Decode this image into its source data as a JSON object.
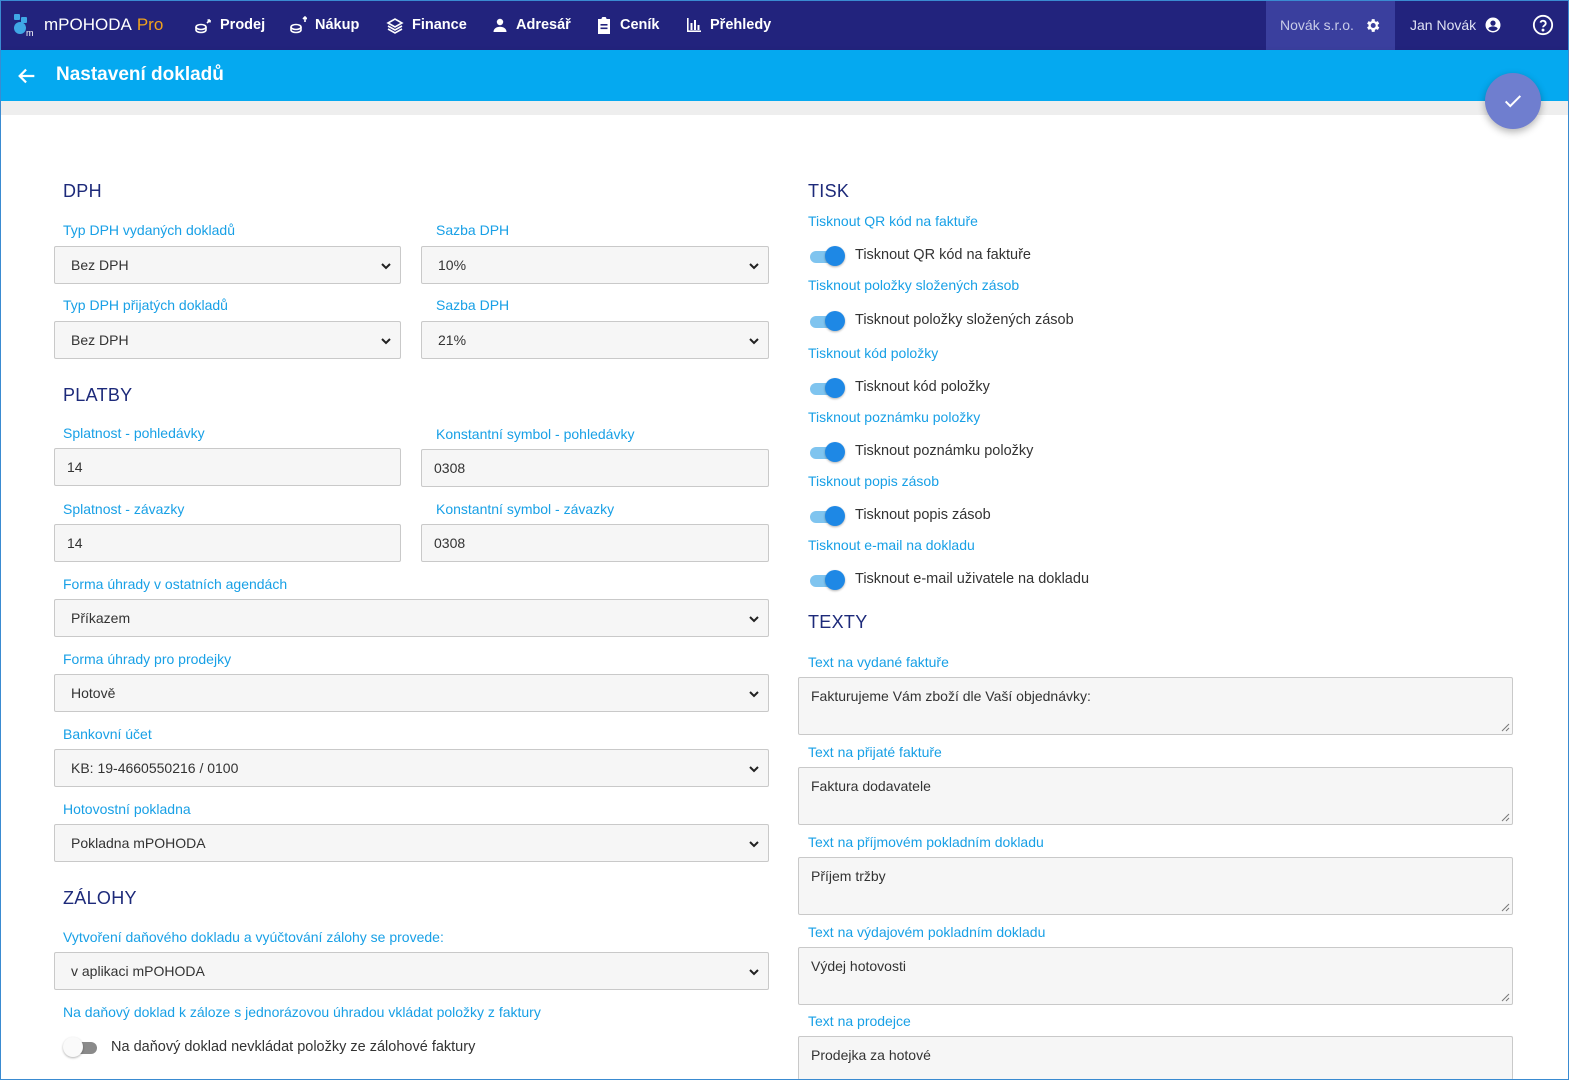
{
  "nav": {
    "logo_text": "mPOHODA",
    "logo_pro": "Pro",
    "items": [
      "Prodej",
      "Nákup",
      "Finance",
      "Adresář",
      "Ceník",
      "Přehledy"
    ],
    "company": "Novák s.r.o.",
    "user": "Jan Novák"
  },
  "header": {
    "title": "Nastavení dokladů"
  },
  "dph": {
    "title": "DPH",
    "vydane_label": "Typ DPH vydaných dokladů",
    "vydane_value": "Bez DPH",
    "sazba1_label": "Sazba DPH",
    "sazba1_value": "10%",
    "prijate_label": "Typ DPH přijatých dokladů",
    "prijate_value": "Bez DPH",
    "sazba2_label": "Sazba DPH",
    "sazba2_value": "21%"
  },
  "platby": {
    "title": "PLATBY",
    "spl_pohl_label": "Splatnost - pohledávky",
    "spl_pohl_value": "14",
    "ks_pohl_label": "Konstantní symbol - pohledávky",
    "ks_pohl_value": "0308",
    "spl_zav_label": "Splatnost - závazky",
    "spl_zav_value": "14",
    "ks_zav_label": "Konstantní symbol - závazky",
    "ks_zav_value": "0308",
    "forma_ost_label": "Forma úhrady v ostatních agendách",
    "forma_ost_value": "Příkazem",
    "forma_prod_label": "Forma úhrady pro prodejky",
    "forma_prod_value": "Hotově",
    "ucet_label": "Bankovní účet",
    "ucet_value": "KB: 19-4660550216 / 0100",
    "pokladna_label": "Hotovostní pokladna",
    "pokladna_value": "Pokladna mPOHODA"
  },
  "zalohy": {
    "title": "ZÁLOHY",
    "vytvoreni_label": "Vytvoření daňového dokladu a vyúčtování zálohy se provede:",
    "vytvoreni_value": "v aplikaci mPOHODA",
    "polozky_label": "Na daňový doklad k záloze s jednorázovou úhradou vkládat položky z faktury",
    "polozky_toggle": "Na daňový doklad nevkládat položky ze zálohové faktury"
  },
  "tisk": {
    "title": "TISK",
    "items": [
      {
        "label": "Tisknout QR kód na faktuře",
        "toggle": "Tisknout QR kód na faktuře"
      },
      {
        "label": "Tisknout položky složených zásob",
        "toggle": "Tisknout položky složených zásob"
      },
      {
        "label": "Tisknout kód položky",
        "toggle": "Tisknout kód položky"
      },
      {
        "label": "Tisknout poznámku položky",
        "toggle": "Tisknout poznámku položky"
      },
      {
        "label": "Tisknout popis zásob",
        "toggle": "Tisknout popis zásob"
      },
      {
        "label": "Tisknout e-mail na dokladu",
        "toggle": "Tisknout e-mail uživatele na dokladu"
      }
    ]
  },
  "texty": {
    "title": "TEXTY",
    "items": [
      {
        "label": "Text na vydané faktuře",
        "value": "Fakturujeme Vám zboží dle Vaší objednávky:"
      },
      {
        "label": "Text na přijaté faktuře",
        "value": "Faktura dodavatele"
      },
      {
        "label": "Text na příjmovém pokladním dokladu",
        "value": "Příjem tržby"
      },
      {
        "label": "Text na výdajovém pokladním dokladu",
        "value": "Výdej hotovosti"
      },
      {
        "label": "Text na prodejce",
        "value": "Prodejka za hotové"
      }
    ]
  }
}
